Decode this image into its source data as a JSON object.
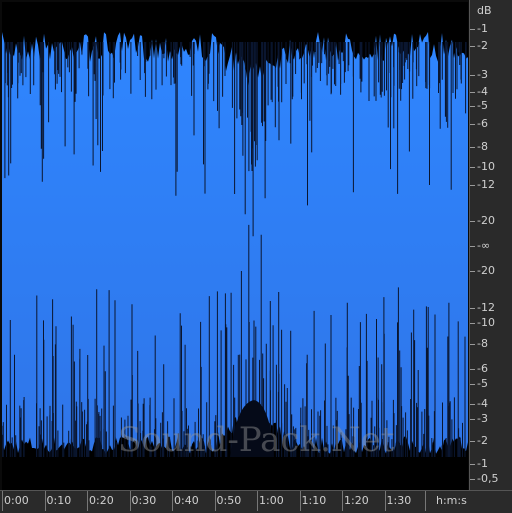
{
  "db_ruler": {
    "labels": [
      "dB",
      "-1",
      "-2",
      "-3",
      "-4",
      "-5",
      "-6",
      "-8",
      "-10",
      "-12",
      "-20",
      "-∞",
      "-20",
      "-12",
      "-10",
      "-8",
      "-6",
      "-5",
      "-4",
      "-3",
      "-2",
      "-1",
      "-0,5"
    ]
  },
  "time_ruler": {
    "labels": [
      "0:00",
      "0:10",
      "0:20",
      "0:30",
      "0:40",
      "0:50",
      "1:00",
      "1:10",
      "1:20",
      "1:30"
    ],
    "unit_label": "h:m:s"
  },
  "watermark": {
    "text": "Sound-Pack.Net"
  },
  "colors": {
    "waveform_top": "#2f86ff",
    "waveform_bottom": "#2f75e8",
    "background": "#000000",
    "ruler": "#2a2a2a"
  }
}
